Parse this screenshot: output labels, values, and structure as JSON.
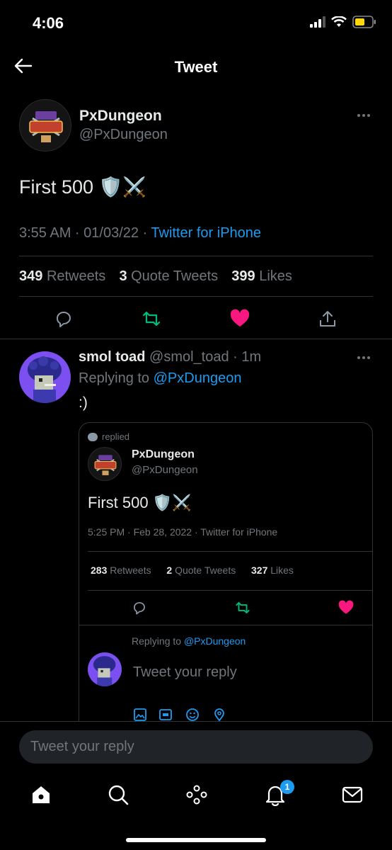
{
  "status_bar": {
    "time": "4:06"
  },
  "header": {
    "title": "Tweet"
  },
  "main_tweet": {
    "author_name": "PxDungeon",
    "author_handle": "@PxDungeon",
    "text": "First 500 🛡️⚔️",
    "timestamp": "3:55 AM · 01/03/22 · ",
    "source": "Twitter for iPhone",
    "retweets": "349",
    "retweets_label": "Retweets",
    "quotes": "3",
    "quotes_label": "Quote Tweets",
    "likes": "399",
    "likes_label": "Likes",
    "like_color": "#f91880",
    "retweet_color": "#00ba7c"
  },
  "reply": {
    "author_name": "smol toad",
    "author_handle": "@smol_toad",
    "time": " · 1m",
    "replying_prefix": "Replying to ",
    "replying_to": "@PxDungeon",
    "text": ":)"
  },
  "quoted": {
    "replied_label": "replied",
    "author_name": "PxDungeon",
    "author_handle": "@PxDungeon",
    "text": "First 500 🛡️⚔️",
    "timestamp": "5:25 PM · Feb 28, 2022 · Twitter for iPhone",
    "retweets": "283",
    "retweets_label": "Retweets",
    "quotes": "2",
    "quotes_label": "Quote Tweets",
    "likes": "327",
    "likes_label": "Likes",
    "replying_prefix": "Replying to ",
    "replying_to": "@PxDungeon",
    "reply_placeholder": "Tweet your reply"
  },
  "bottom": {
    "reply_placeholder": "Tweet your reply",
    "notification_count": "1"
  },
  "colors": {
    "accent": "#1d9bf0",
    "background": "#000000"
  }
}
